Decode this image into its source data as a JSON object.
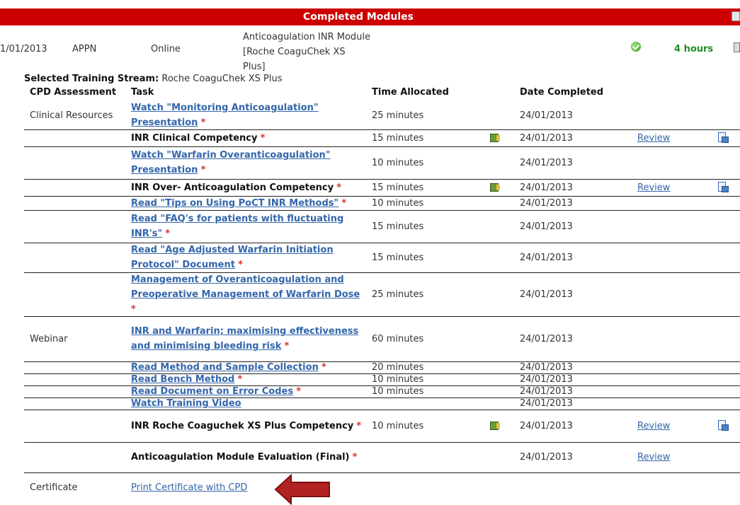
{
  "banner": {
    "title": "Completed Modules"
  },
  "summary": {
    "date": "1/01/2013",
    "provider": "APPN",
    "delivery": "Online",
    "module_title": "Anticoagulation INR Module [Roche CoaguChek XS Plus]",
    "hours": "4 hours"
  },
  "stream": {
    "label": "Selected Training Stream:",
    "value": "Roche CoaguChek XS Plus"
  },
  "headers": {
    "cpd": "CPD Assessment",
    "task": "Task",
    "time": "Time Allocated",
    "date": "Date Completed"
  },
  "rows": [
    {
      "category": "Clinical Resources",
      "task": "Watch \"Monitoring Anticoagulation\" Presentation",
      "req": "*",
      "time": "25 minutes",
      "date": "24/01/2013"
    },
    {
      "category": "",
      "task": "INR Clinical Competency",
      "req": "*",
      "time": "15 minutes",
      "date": "24/01/2013",
      "review": "Review"
    },
    {
      "category": "",
      "task": "Watch \"Warfarin Overanticoagulation\" Presentation",
      "req": "*",
      "time": "10 minutes",
      "date": "24/01/2013"
    },
    {
      "category": "",
      "task": "INR Over- Anticoagulation Competency",
      "req": "*",
      "time": "15 minutes",
      "date": "24/01/2013",
      "review": "Review"
    },
    {
      "category": "",
      "task": "Read \"Tips on Using PoCT INR Methods\"",
      "req": "*",
      "time": "10 minutes",
      "date": "24/01/2013"
    },
    {
      "category": "",
      "task": "Read \"FAQ's for patients with fluctuating INR's\"",
      "req": "*",
      "time": "15 minutes",
      "date": "24/01/2013"
    },
    {
      "category": "",
      "task": "Read \"Age Adjusted Warfarin Initiation Protocol\" Document",
      "req": "*",
      "time": "15 minutes",
      "date": "24/01/2013"
    },
    {
      "category": "",
      "task": "Management of Overanticoagulation and Preoperative Management of Warfarin Dose",
      "req": "*",
      "time": "25 minutes",
      "date": "24/01/2013"
    },
    {
      "category": "Webinar",
      "task": "INR and Warfarin; maximising effectiveness and minimising bleeding risk",
      "req": "*",
      "time": "60 minutes",
      "date": "24/01/2013"
    },
    {
      "category": "",
      "task": "Read Method and Sample Collection",
      "req": "*",
      "time": "20 minutes",
      "date": "24/01/2013"
    },
    {
      "category": "",
      "task": "Read Bench Method",
      "req": "*",
      "time": "10 minutes",
      "date": "24/01/2013"
    },
    {
      "category": "",
      "task": "Read Document on Error Codes",
      "req": "*",
      "time": "10 minutes",
      "date": "24/01/2013"
    },
    {
      "category": "",
      "task": "Watch Training Video",
      "req": "",
      "time": "",
      "date": "24/01/2013"
    },
    {
      "category": "",
      "task": "INR Roche Coaguchek XS Plus Competency",
      "req": "*",
      "time": "10 minutes",
      "date": "24/01/2013",
      "review": "Review"
    },
    {
      "category": "",
      "task": "Anticoagulation Module Evaluation (Final)",
      "req": "*",
      "time": "",
      "date": "24/01/2013",
      "review": "Review"
    }
  ],
  "certificate": {
    "category": "Certificate",
    "link": "Print Certificate with CPD"
  },
  "colors": {
    "banner": "#cc0000",
    "link": "#3366aa",
    "required": "#e03030",
    "hours": "#228b22",
    "arrow": "#b22222"
  }
}
